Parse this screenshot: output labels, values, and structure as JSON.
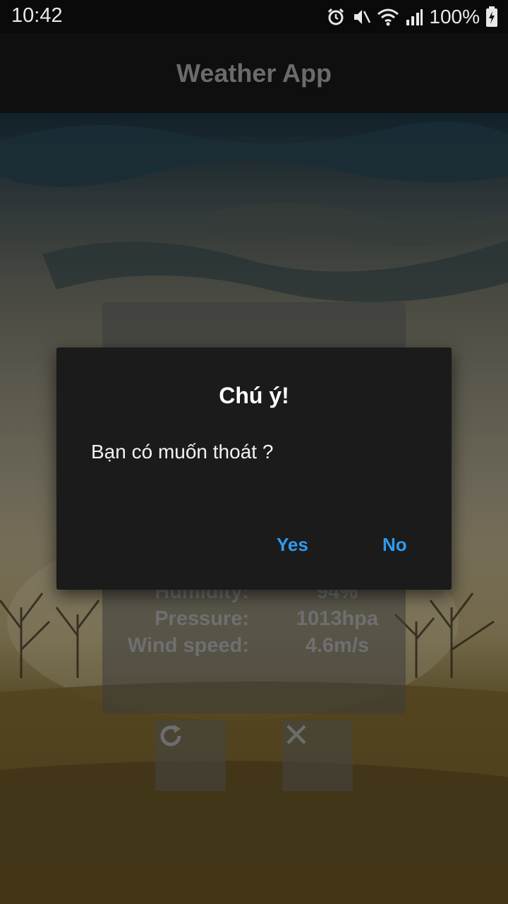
{
  "status_bar": {
    "time": "10:42",
    "battery": "100%",
    "icons": [
      "alarm-icon",
      "mute-icon",
      "wifi-icon",
      "signal-icon",
      "battery-charging-icon"
    ]
  },
  "app_bar": {
    "title": "Weather App"
  },
  "weather_card": {
    "rows": [
      {
        "label": "Humidity:",
        "value": "94%"
      },
      {
        "label": "Pressure:",
        "value": "1013hpa"
      },
      {
        "label": "Wind speed:",
        "value": "4.6m/s"
      }
    ]
  },
  "actions": {
    "refresh_icon": "refresh-icon",
    "close_icon": "close-icon"
  },
  "dialog": {
    "title": "Chú ý!",
    "message": "Bạn có muốn thoát ?",
    "positive_label": "Yes",
    "negative_label": "No",
    "accent_color": "#2e9bf0"
  }
}
